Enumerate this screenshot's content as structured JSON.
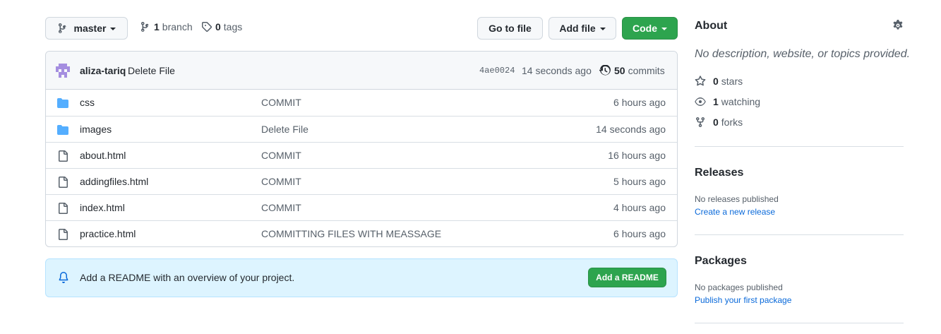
{
  "toolbar": {
    "branch_label": "master",
    "branches_count": "1",
    "branches_label": "branch",
    "tags_count": "0",
    "tags_label": "tags",
    "go_to_file": "Go to file",
    "add_file": "Add file",
    "code": "Code"
  },
  "latest_commit": {
    "author": "aliza-tariq",
    "message": "Delete File",
    "sha": "4ae0024",
    "time": "14 seconds ago",
    "commits_count": "50",
    "commits_label": "commits"
  },
  "files": [
    {
      "type": "folder",
      "name": "css",
      "message": "COMMIT",
      "age": "6 hours ago"
    },
    {
      "type": "folder",
      "name": "images",
      "message": "Delete File",
      "age": "14 seconds ago"
    },
    {
      "type": "file",
      "name": "about.html",
      "message": "COMMIT",
      "age": "16 hours ago"
    },
    {
      "type": "file",
      "name": "addingfiles.html",
      "message": "COMMIT",
      "age": "5 hours ago"
    },
    {
      "type": "file",
      "name": "index.html",
      "message": "COMMIT",
      "age": "4 hours ago"
    },
    {
      "type": "file",
      "name": "practice.html",
      "message": "COMMITTING FILES WITH MEASSAGE",
      "age": "6 hours ago"
    }
  ],
  "readme_banner": {
    "text": "Add a README with an overview of your project.",
    "button": "Add a README"
  },
  "about": {
    "title": "About",
    "description": "No description, website, or topics provided.",
    "stars_count": "0",
    "stars_label": "stars",
    "watching_count": "1",
    "watching_label": "watching",
    "forks_count": "0",
    "forks_label": "forks"
  },
  "releases": {
    "title": "Releases",
    "none_text": "No releases published",
    "link": "Create a new release"
  },
  "packages": {
    "title": "Packages",
    "none_text": "No packages published",
    "link": "Publish your first package"
  },
  "colors": {
    "green": "#2da44e",
    "folder_blue": "#54aeff",
    "link_blue": "#0969da",
    "banner_bg": "#ddf4ff"
  }
}
